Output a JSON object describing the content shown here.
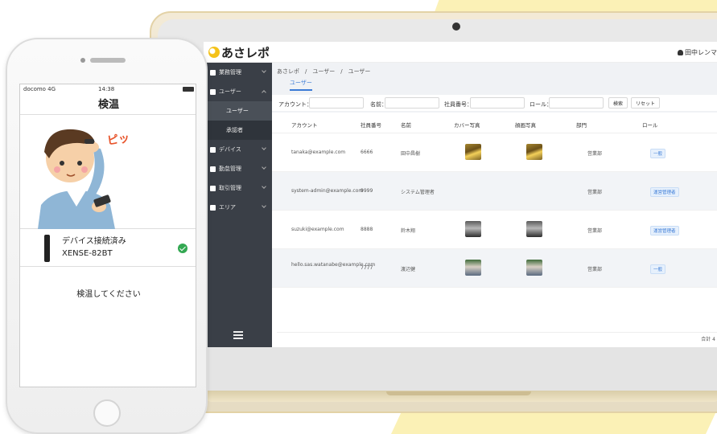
{
  "app": {
    "logo": "あさレポ",
    "user": "田中レンマ"
  },
  "sidebar": {
    "items": [
      {
        "label": "業務管理"
      },
      {
        "label": "ユーザー"
      },
      {
        "label": "デバイス"
      },
      {
        "label": "勤怠管理"
      },
      {
        "label": "取引管理"
      },
      {
        "label": "エリア"
      }
    ],
    "sub_items": [
      {
        "label": "ユーザー"
      },
      {
        "label": "承認者"
      }
    ]
  },
  "main": {
    "breadcrumb": "あさレポ　/　ユーザー　/　ユーザー",
    "tab": "ユーザー",
    "search": {
      "account_label": "アカウント：",
      "name_label": "名前：",
      "employee_no_label": "社員番号：",
      "role_label": "ロール：",
      "search_button": "検索",
      "reset_button": "リセット"
    },
    "columns": [
      "アカウント",
      "社員番号",
      "名前",
      "カバー写真",
      "顔画写真",
      "部門",
      "ロール"
    ],
    "rows": [
      {
        "account": "tanaka@example.com",
        "employee_no": "6666",
        "name": "田中昌樹",
        "department": "営業部",
        "role": "一般"
      },
      {
        "account": "system-admin@example.com",
        "employee_no": "9999",
        "name": "システム管理者",
        "department": "営業部",
        "role": "運営管理者"
      },
      {
        "account": "suzuki@example.com",
        "employee_no": "8888",
        "name": "鈴木翔",
        "department": "営業部",
        "role": "運営管理者"
      },
      {
        "account": "hello.sas.watanabe@example.com",
        "employee_no": "7777",
        "name": "渡辺健",
        "department": "営業部",
        "role": "一般"
      }
    ],
    "total": "合計 4"
  },
  "phone": {
    "carrier": "docomo 4G",
    "time": "14:38",
    "title": "検温",
    "sfx": "ピッ",
    "device_status": "デバイス接続済み",
    "device_name": "XENSE-82BT",
    "instruction": "検温してください"
  }
}
